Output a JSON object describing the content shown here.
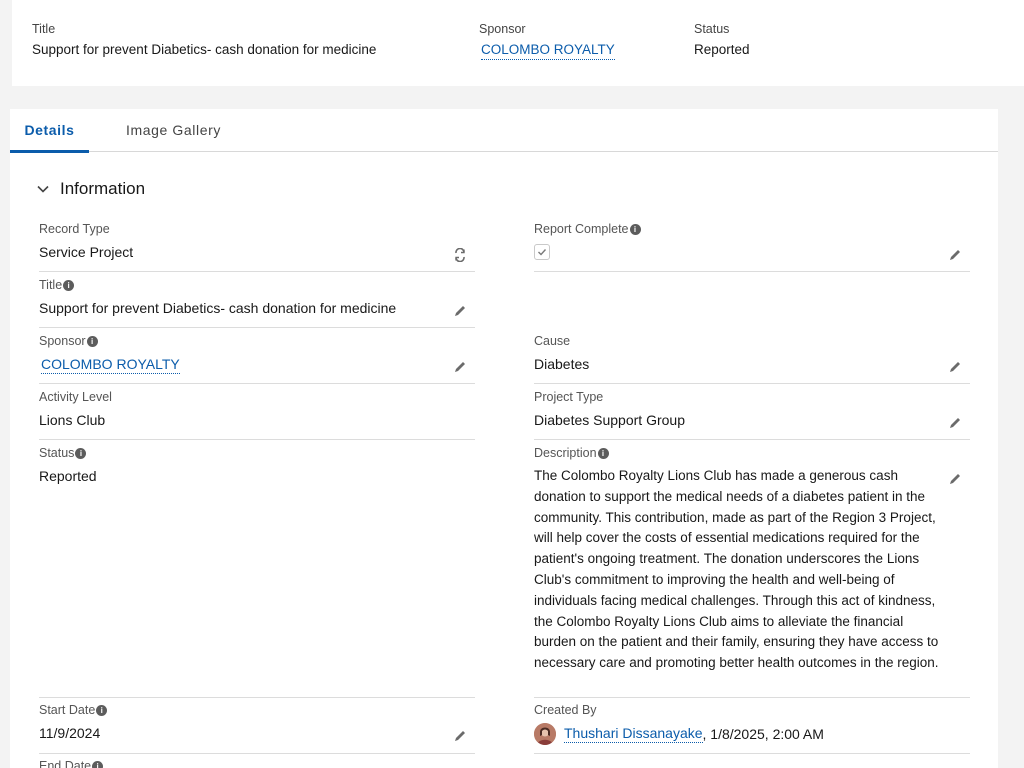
{
  "highlights": {
    "title_label": "Title",
    "title_value": "Support for prevent Diabetics- cash donation for medicine",
    "sponsor_label": "Sponsor",
    "sponsor_value": "COLOMBO ROYALTY",
    "status_label": "Status",
    "status_value": "Reported"
  },
  "tabs": [
    {
      "label": "Details",
      "active": true
    },
    {
      "label": "Image Gallery",
      "active": false
    }
  ],
  "section": {
    "title": "Information",
    "icon": "chevron-down-icon"
  },
  "fields": {
    "record_type": {
      "label": "Record Type",
      "value": "Service Project"
    },
    "report_complete": {
      "label": "Report Complete",
      "checked": true
    },
    "title": {
      "label": "Title",
      "value": "Support for prevent Diabetics- cash donation for medicine"
    },
    "sponsor": {
      "label": "Sponsor",
      "value": "COLOMBO ROYALTY"
    },
    "cause": {
      "label": "Cause",
      "value": "Diabetes"
    },
    "activity_level": {
      "label": "Activity Level",
      "value": "Lions Club"
    },
    "project_type": {
      "label": "Project Type",
      "value": "Diabetes Support Group"
    },
    "status": {
      "label": "Status",
      "value": "Reported"
    },
    "description": {
      "label": "Description",
      "value": "The Colombo Royalty Lions Club has made a generous cash donation to support the medical needs of a diabetes patient in the community. This contribution, made as part of the Region 3 Project, will help cover the costs of essential medications required for the patient's ongoing treatment. The donation underscores the Lions Club's commitment to improving the health and well-being of individuals facing medical challenges. Through this act of kindness, the Colombo Royalty Lions Club aims to alleviate the financial burden on the patient and their family, ensuring they have access to necessary care and promoting better health outcomes in the region."
    },
    "start_date": {
      "label": "Start Date",
      "value": "11/9/2024"
    },
    "created_by": {
      "label": "Created By",
      "user": "Thushari Dissanayake",
      "timestamp": ", 1/8/2025, 2:00 AM"
    },
    "end_date": {
      "label": "End Date"
    }
  },
  "colors": {
    "accent": "#0b5cab",
    "background": "#f3f3f3"
  }
}
